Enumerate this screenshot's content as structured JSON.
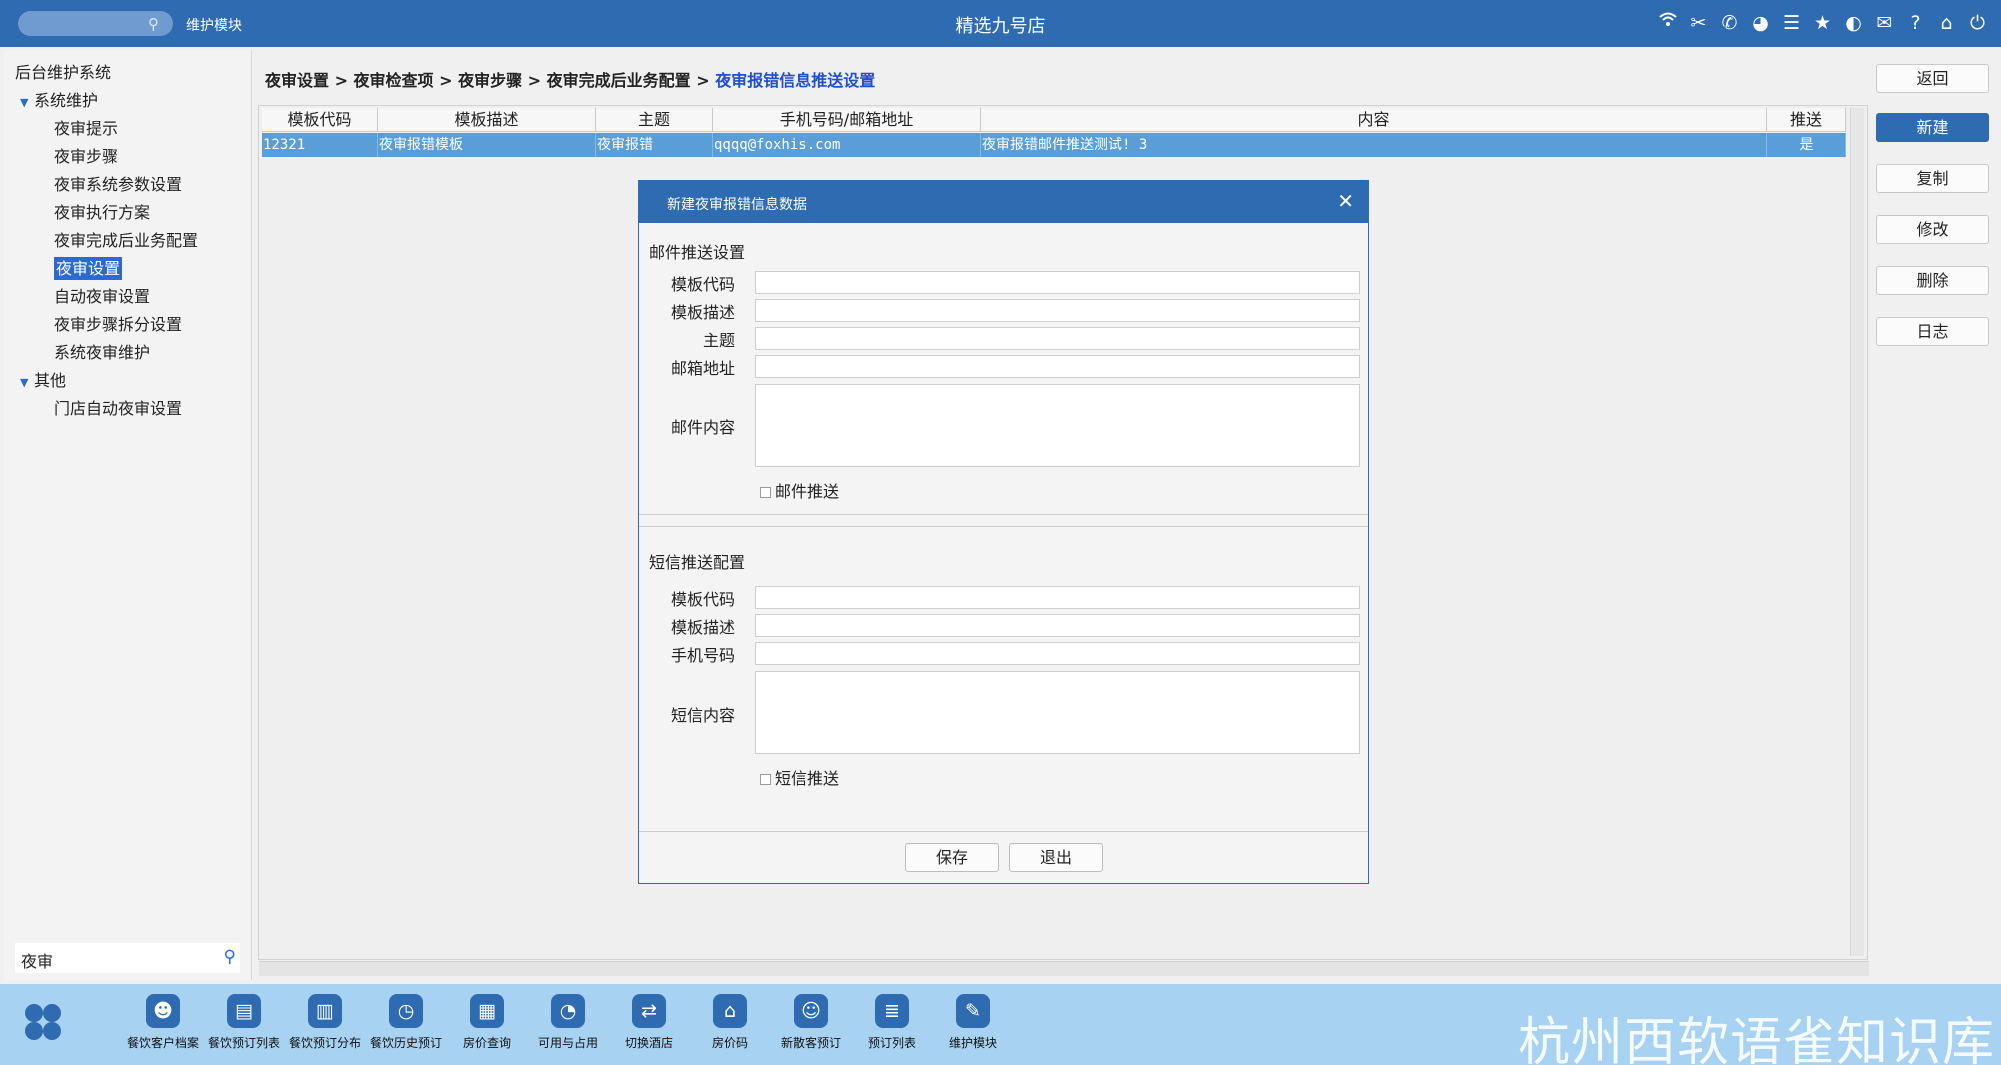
{
  "header": {
    "module_name": "维护模块",
    "title": "精选九号店",
    "icons": [
      "wifi-icon",
      "tools-icon",
      "phone-icon",
      "palette-icon",
      "menu-icon",
      "star-icon",
      "moon-icon",
      "mail-icon",
      "help-icon",
      "home-icon",
      "power-icon"
    ]
  },
  "sidebar": {
    "root": "后台维护系统",
    "groups": [
      {
        "label": "系统维护",
        "items": [
          "夜审提示",
          "夜审步骤",
          "夜审系统参数设置",
          "夜审执行方案",
          "夜审完成后业务配置",
          "夜审设置",
          "自动夜审设置",
          "夜审步骤拆分设置",
          "系统夜审维护"
        ]
      },
      {
        "label": "其他",
        "items": [
          "门店自动夜审设置"
        ]
      }
    ],
    "selected": "夜审设置",
    "search_value": "夜审"
  },
  "breadcrumb": {
    "path": "夜审设置 > 夜审检查项 > 夜审步骤 > 夜审完成后业务配置 >",
    "current": "夜审报错信息推送设置"
  },
  "table": {
    "headers": [
      "模板代码",
      "模板描述",
      "主题",
      "手机号码/邮箱地址",
      "内容",
      "推送"
    ],
    "rows": [
      [
        "12321",
        "夜审报错模板",
        "夜审报错",
        "qqqq@foxhis.com",
        "夜审报错邮件推送测试! 3",
        "是"
      ]
    ]
  },
  "actions": {
    "back": "返回",
    "new": "新建",
    "copy": "复制",
    "edit": "修改",
    "delete": "删除",
    "log": "日志"
  },
  "dialog": {
    "title": "新建夜审报错信息数据",
    "email_section": {
      "title": "邮件推送设置",
      "labels": [
        "模板代码",
        "模板描述",
        "主题",
        "邮箱地址"
      ],
      "content_label": "邮件内容",
      "checkbox": "邮件推送",
      "checked": false
    },
    "sms_section": {
      "title": "短信推送配置",
      "labels": [
        "模板代码",
        "模板描述",
        "手机号码"
      ],
      "content_label": "短信内容",
      "checkbox": "短信推送",
      "checked": false
    },
    "save": "保存",
    "exit": "退出"
  },
  "taskbar": {
    "items": [
      {
        "label": "餐饮客户档案",
        "icon": "user-icon"
      },
      {
        "label": "餐饮预订列表",
        "icon": "clipboard-icon"
      },
      {
        "label": "餐饮预订分布",
        "icon": "building-icon"
      },
      {
        "label": "餐饮历史预订",
        "icon": "clock-icon"
      },
      {
        "label": "房价查询",
        "icon": "search-doc-icon"
      },
      {
        "label": "可用与占用",
        "icon": "pie-icon"
      },
      {
        "label": "切换酒店",
        "icon": "switch-icon"
      },
      {
        "label": "房价码",
        "icon": "house-icon"
      },
      {
        "label": "新散客预订",
        "icon": "add-user-icon"
      },
      {
        "label": "预订列表",
        "icon": "list-icon"
      },
      {
        "label": "维护模块",
        "icon": "wrench-icon"
      }
    ]
  },
  "watermark": "杭州西软语雀知识库",
  "colors": {
    "brand_blue": "#2e6bb1",
    "row_selected": "#5a9ed8",
    "nav_selected": "#2a6ad2",
    "taskbar": "#a7d2f2",
    "breadcrumb_current": "#1f4fcf"
  }
}
